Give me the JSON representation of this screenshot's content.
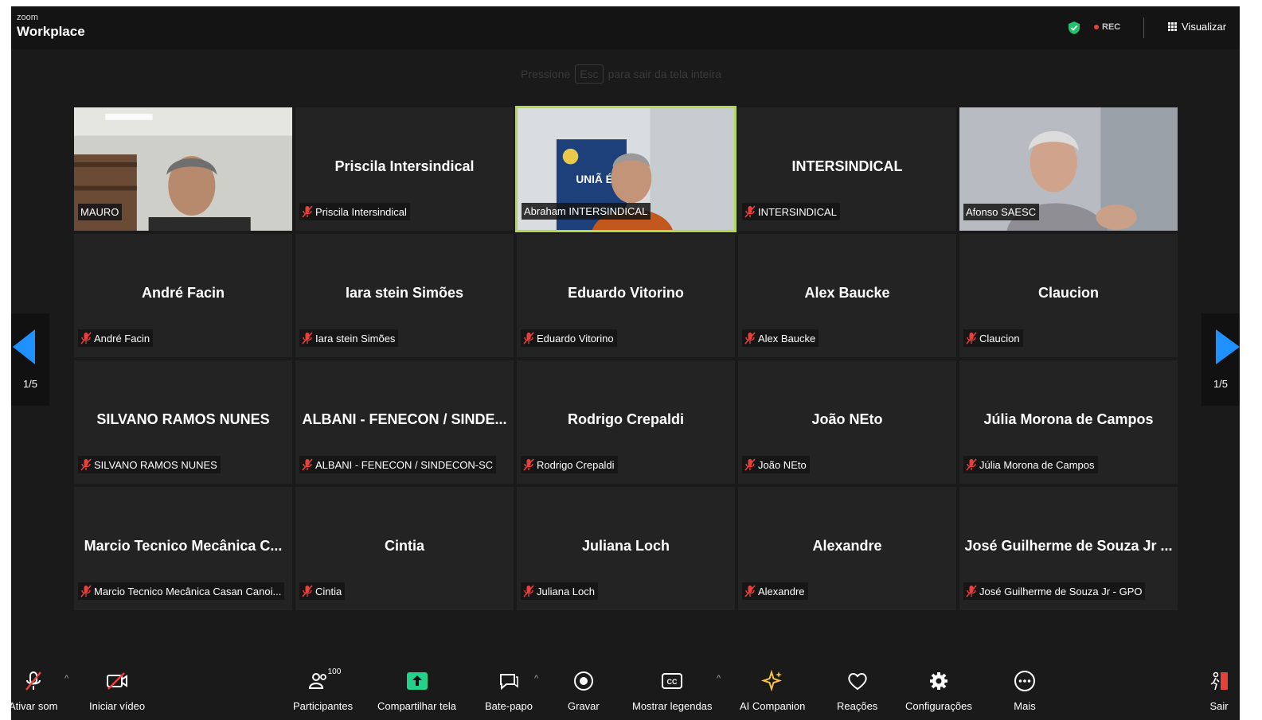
{
  "app": {
    "logo_small": "zoom",
    "logo_big": "Workplace"
  },
  "header": {
    "rec_label": "REC",
    "view_label": "Visualizar"
  },
  "hint": {
    "prefix": "Pressione",
    "key": "Esc",
    "suffix": "para sair da tela inteira"
  },
  "pagination": {
    "left": "1/5",
    "right": "1/5"
  },
  "tiles": [
    {
      "display": "",
      "label": "MAURO",
      "muted": false,
      "video": true
    },
    {
      "display": "Priscila Intersindical",
      "label": "Priscila Intersindical",
      "muted": true,
      "video": false
    },
    {
      "display": "",
      "label": "Abraham INTERSINDICAL",
      "muted": false,
      "video": true
    },
    {
      "display": "INTERSINDICAL",
      "label": "INTERSINDICAL",
      "muted": true,
      "video": false
    },
    {
      "display": "",
      "label": "Afonso SAESC",
      "muted": false,
      "video": true
    },
    {
      "display": "André Facin",
      "label": "André Facin",
      "muted": true,
      "video": false
    },
    {
      "display": "Iara stein Simões",
      "label": "Iara stein Simões",
      "muted": true,
      "video": false
    },
    {
      "display": "Eduardo Vitorino",
      "label": "Eduardo Vitorino",
      "muted": true,
      "video": false
    },
    {
      "display": "Alex Baucke",
      "label": "Alex Baucke",
      "muted": true,
      "video": false
    },
    {
      "display": "Claucion",
      "label": "Claucion",
      "muted": true,
      "video": false
    },
    {
      "display": "SILVANO RAMOS NUNES",
      "label": "SILVANO RAMOS NUNES",
      "muted": true,
      "video": false
    },
    {
      "display": "ALBANI - FENECON / SINDE...",
      "label": "ALBANI - FENECON / SINDECON-SC",
      "muted": true,
      "video": false
    },
    {
      "display": "Rodrigo Crepaldi",
      "label": "Rodrigo Crepaldi",
      "muted": true,
      "video": false
    },
    {
      "display": "João NEto",
      "label": "João NEto",
      "muted": true,
      "video": false
    },
    {
      "display": "Júlia Morona de Campos",
      "label": "Júlia Morona de Campos",
      "muted": true,
      "video": false
    },
    {
      "display": "Marcio Tecnico Mecânica C...",
      "label": "Marcio Tecnico Mecânica Casan Canoi...",
      "muted": true,
      "video": false
    },
    {
      "display": "Cintia",
      "label": "Cintia",
      "muted": true,
      "video": false
    },
    {
      "display": "Juliana Loch",
      "label": "Juliana Loch",
      "muted": true,
      "video": false
    },
    {
      "display": "Alexandre",
      "label": "Alexandre",
      "muted": true,
      "video": false
    },
    {
      "display": "José Guilherme de Souza Jr ...",
      "label": "José Guilherme de Souza Jr - GPO",
      "muted": true,
      "video": false
    }
  ],
  "video_banner_text": "UNIÃ É FOR",
  "toolbar": {
    "unmute": "Ativar som",
    "start_video": "Iniciar vídeo",
    "participants": "Participantes",
    "participants_count": "100",
    "share": "Compartilhar tela",
    "chat": "Bate-papo",
    "record": "Gravar",
    "captions": "Mostrar legendas",
    "companion": "AI Companion",
    "reactions": "Reações",
    "settings": "Configurações",
    "more": "Mais",
    "leave": "Sair"
  },
  "colors": {
    "active_border": "#b3d94e",
    "share_green": "#23d18b",
    "arrow_blue": "#1e90ff",
    "mute_red": "#e8413b"
  }
}
